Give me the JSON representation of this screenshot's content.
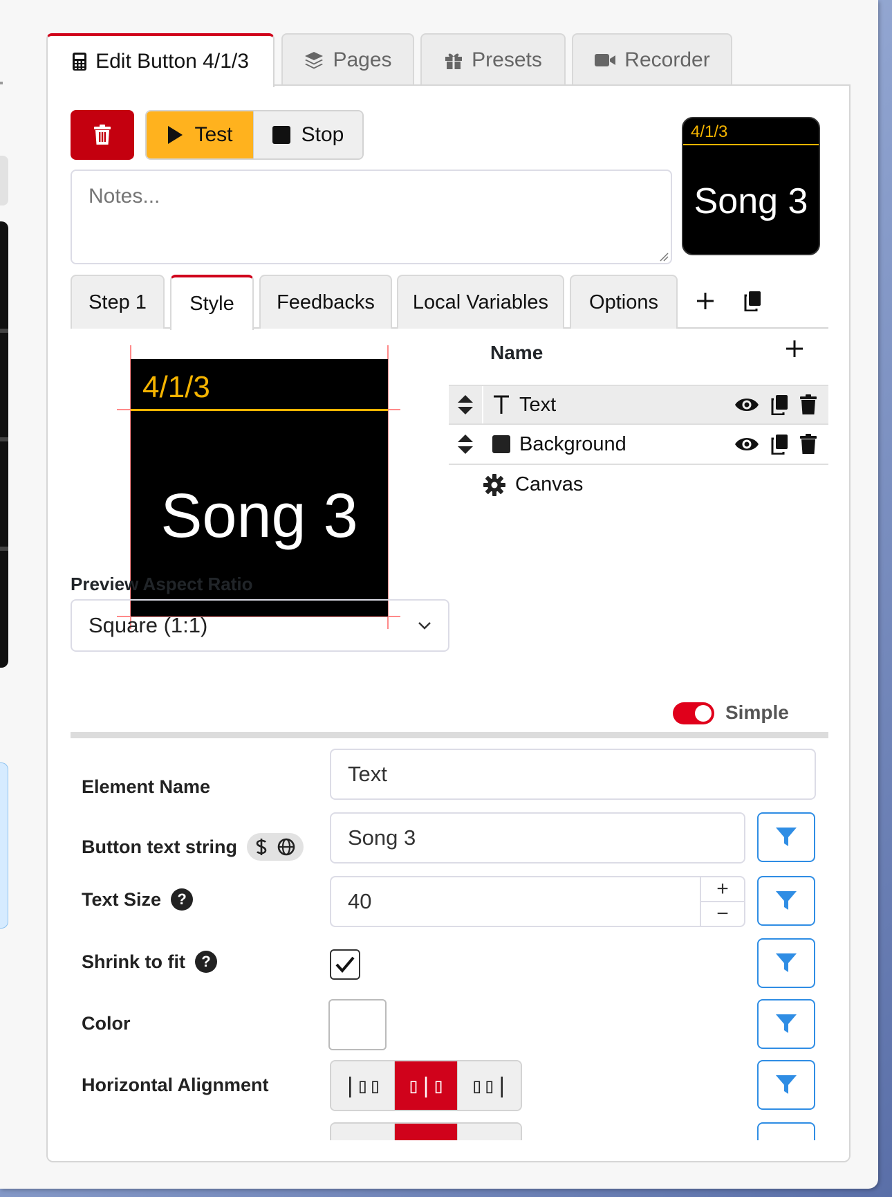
{
  "top_tabs": [
    {
      "label": "Edit Button 4/1/3",
      "icon": "calculator-icon"
    },
    {
      "label": "Pages",
      "icon": "layers-icon"
    },
    {
      "label": "Presets",
      "icon": "gift-icon"
    },
    {
      "label": "Recorder",
      "icon": "video-camera-icon"
    }
  ],
  "toolbar": {
    "delete_icon": "trash-icon",
    "test_label": "Test",
    "stop_label": "Stop",
    "notes_placeholder": "Notes..."
  },
  "mini_preview": {
    "location": "4/1/3",
    "text": "Song 3"
  },
  "sub_tabs": [
    "Step 1",
    "Style",
    "Feedbacks",
    "Local Variables",
    "Options"
  ],
  "preview": {
    "location": "4/1/3",
    "text": "Song 3"
  },
  "elements": {
    "header": "Name",
    "rows": [
      {
        "name": "Text",
        "icon": "text-t-icon",
        "selected": true
      },
      {
        "name": "Background",
        "icon": "square-icon",
        "selected": false
      }
    ],
    "canvas_label": "Canvas"
  },
  "aspect": {
    "label": "Preview Aspect Ratio",
    "value": "Square (1:1)"
  },
  "mode_toggle": {
    "label": "Simple",
    "on": true
  },
  "form": {
    "element_name_label": "Element Name",
    "element_name_value": "Text",
    "button_text_label": "Button text string",
    "button_text_value": "Song 3",
    "text_size_label": "Text Size",
    "text_size_value": "40",
    "shrink_label": "Shrink to fit",
    "shrink_checked": true,
    "color_label": "Color",
    "color_value": "#ffffff",
    "halign_label": "Horizontal Alignment",
    "halign_options": [
      "|▯▯",
      "▯|▯",
      "▯▯|"
    ],
    "halign_selected": 1
  },
  "colors": {
    "accent_red": "#d0021b",
    "test_yellow": "#ffb21e",
    "filter_blue": "#2f8de4",
    "label_yellow": "#f5b400"
  }
}
